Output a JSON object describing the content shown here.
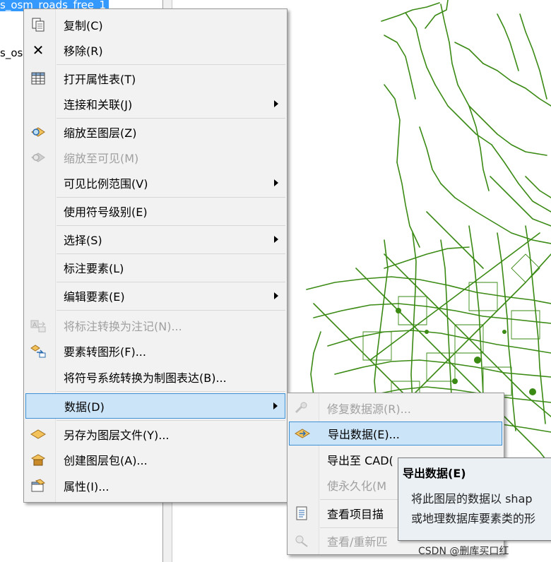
{
  "toc": {
    "selected_layer": "s_osm_roads_free_1",
    "second_layer": "s_os"
  },
  "context_menu": {
    "items": [
      {
        "label": "复制(C)",
        "icon": "copy-icon"
      },
      {
        "label": "移除(R)",
        "icon": "remove-x-icon"
      },
      {
        "label": "打开属性表(T)",
        "icon": "table-icon"
      },
      {
        "label": "连接和关联(J)",
        "icon": "none",
        "submenu": true
      },
      {
        "label": "缩放至图层(Z)",
        "icon": "zoom-to-layer-icon"
      },
      {
        "label": "缩放至可见(M)",
        "icon": "zoom-to-visible-icon",
        "disabled": true
      },
      {
        "label": "可见比例范围(V)",
        "icon": "none",
        "submenu": true
      },
      {
        "label": "使用符号级别(E)",
        "icon": "none"
      },
      {
        "label": "选择(S)",
        "icon": "none",
        "submenu": true
      },
      {
        "label": "标注要素(L)",
        "icon": "none"
      },
      {
        "label": "编辑要素(E)",
        "icon": "none",
        "submenu": true
      },
      {
        "label": "将标注转换为注记(N)...",
        "icon": "convert-labels-icon",
        "disabled": true
      },
      {
        "label": "要素转图形(F)...",
        "icon": "features-to-graphics-icon"
      },
      {
        "label": "将符号系统转换为制图表达(B)...",
        "icon": "none"
      },
      {
        "label": "数据(D)",
        "icon": "none",
        "submenu": true,
        "highlighted": true
      },
      {
        "label": "另存为图层文件(Y)...",
        "icon": "save-layer-icon"
      },
      {
        "label": "创建图层包(A)...",
        "icon": "layer-package-icon"
      },
      {
        "label": "属性(I)...",
        "icon": "properties-icon"
      }
    ]
  },
  "data_submenu": {
    "items": [
      {
        "label": "修复数据源(R)...",
        "icon": "repair-source-icon",
        "disabled": true
      },
      {
        "label": "导出数据(E)...",
        "icon": "export-data-icon",
        "highlighted": true
      },
      {
        "label": "导出至 CAD(",
        "icon": "none"
      },
      {
        "label": "使永久化(M",
        "icon": "none",
        "disabled": true
      },
      {
        "label": "查看项目描",
        "icon": "item-description-icon"
      },
      {
        "label": "查看/重新匹",
        "icon": "rematch-icon",
        "disabled": true
      }
    ]
  },
  "tooltip": {
    "title": "导出数据(E)",
    "line1": "将此图层的数据以 shap",
    "line2": "或地理数据库要素类的形"
  },
  "watermark": "CSDN @删库买口红",
  "colors": {
    "road": "#3a8a14",
    "highlight_fill": "#cce4f7",
    "highlight_border": "#3d8fd6",
    "selection": "#3399ff"
  }
}
